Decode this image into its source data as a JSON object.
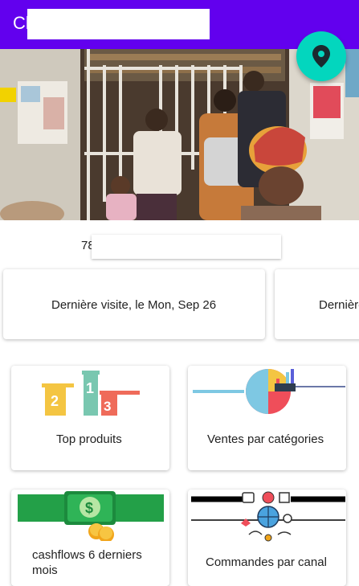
{
  "app_bar": {
    "title_prefix": "Cl"
  },
  "fab": {
    "icon": "location-pin-icon",
    "color": "#03d6be"
  },
  "subtitle": {
    "prefix": "78"
  },
  "visits": [
    {
      "label": "Dernière visite, le Mon, Sep 26"
    },
    {
      "label": "Dernière"
    }
  ],
  "tiles": {
    "top_products": {
      "label": "Top produits",
      "icon": "podium-icon"
    },
    "sales_by_category": {
      "label": "Ventes par catégories",
      "icon": "pie-chart-icon"
    },
    "cashflows": {
      "label": "cashflows 6 derniers mois",
      "icon": "money-icon"
    },
    "orders_by_channel": {
      "label": "Commandes par canal",
      "icon": "network-icon"
    }
  },
  "colors": {
    "primary": "#6200ee",
    "accent": "#03d6be"
  }
}
